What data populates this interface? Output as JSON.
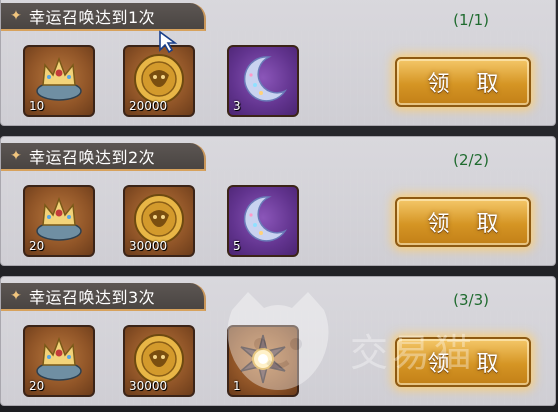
{
  "tasks": [
    {
      "title": "幸运召唤达到1次",
      "progress": "(1/1)",
      "items": [
        {
          "icon": "crown-cushion-icon",
          "qty": "10"
        },
        {
          "icon": "gold-coin-icon",
          "qty": "20000"
        },
        {
          "icon": "crescent-moon-icon",
          "qty": "3"
        }
      ],
      "button_label": "领 取"
    },
    {
      "title": "幸运召唤达到2次",
      "progress": "(2/2)",
      "items": [
        {
          "icon": "crown-cushion-icon",
          "qty": "20"
        },
        {
          "icon": "gold-coin-icon",
          "qty": "30000"
        },
        {
          "icon": "crescent-moon-icon",
          "qty": "5"
        }
      ],
      "button_label": "领 取"
    },
    {
      "title": "幸运召唤达到3次",
      "progress": "(3/3)",
      "items": [
        {
          "icon": "crown-cushion-icon",
          "qty": "20"
        },
        {
          "icon": "gold-coin-icon",
          "qty": "30000"
        },
        {
          "icon": "sun-amulet-icon",
          "qty": "1"
        }
      ],
      "button_label": "领 取"
    }
  ],
  "watermark": "交易猫",
  "colors": {
    "title_tab": "#4f4a47",
    "progress_text": "#1f6b2f",
    "claim_button": "#d59524",
    "brown_slot": "#8f5427",
    "purple_slot": "#62348f"
  }
}
